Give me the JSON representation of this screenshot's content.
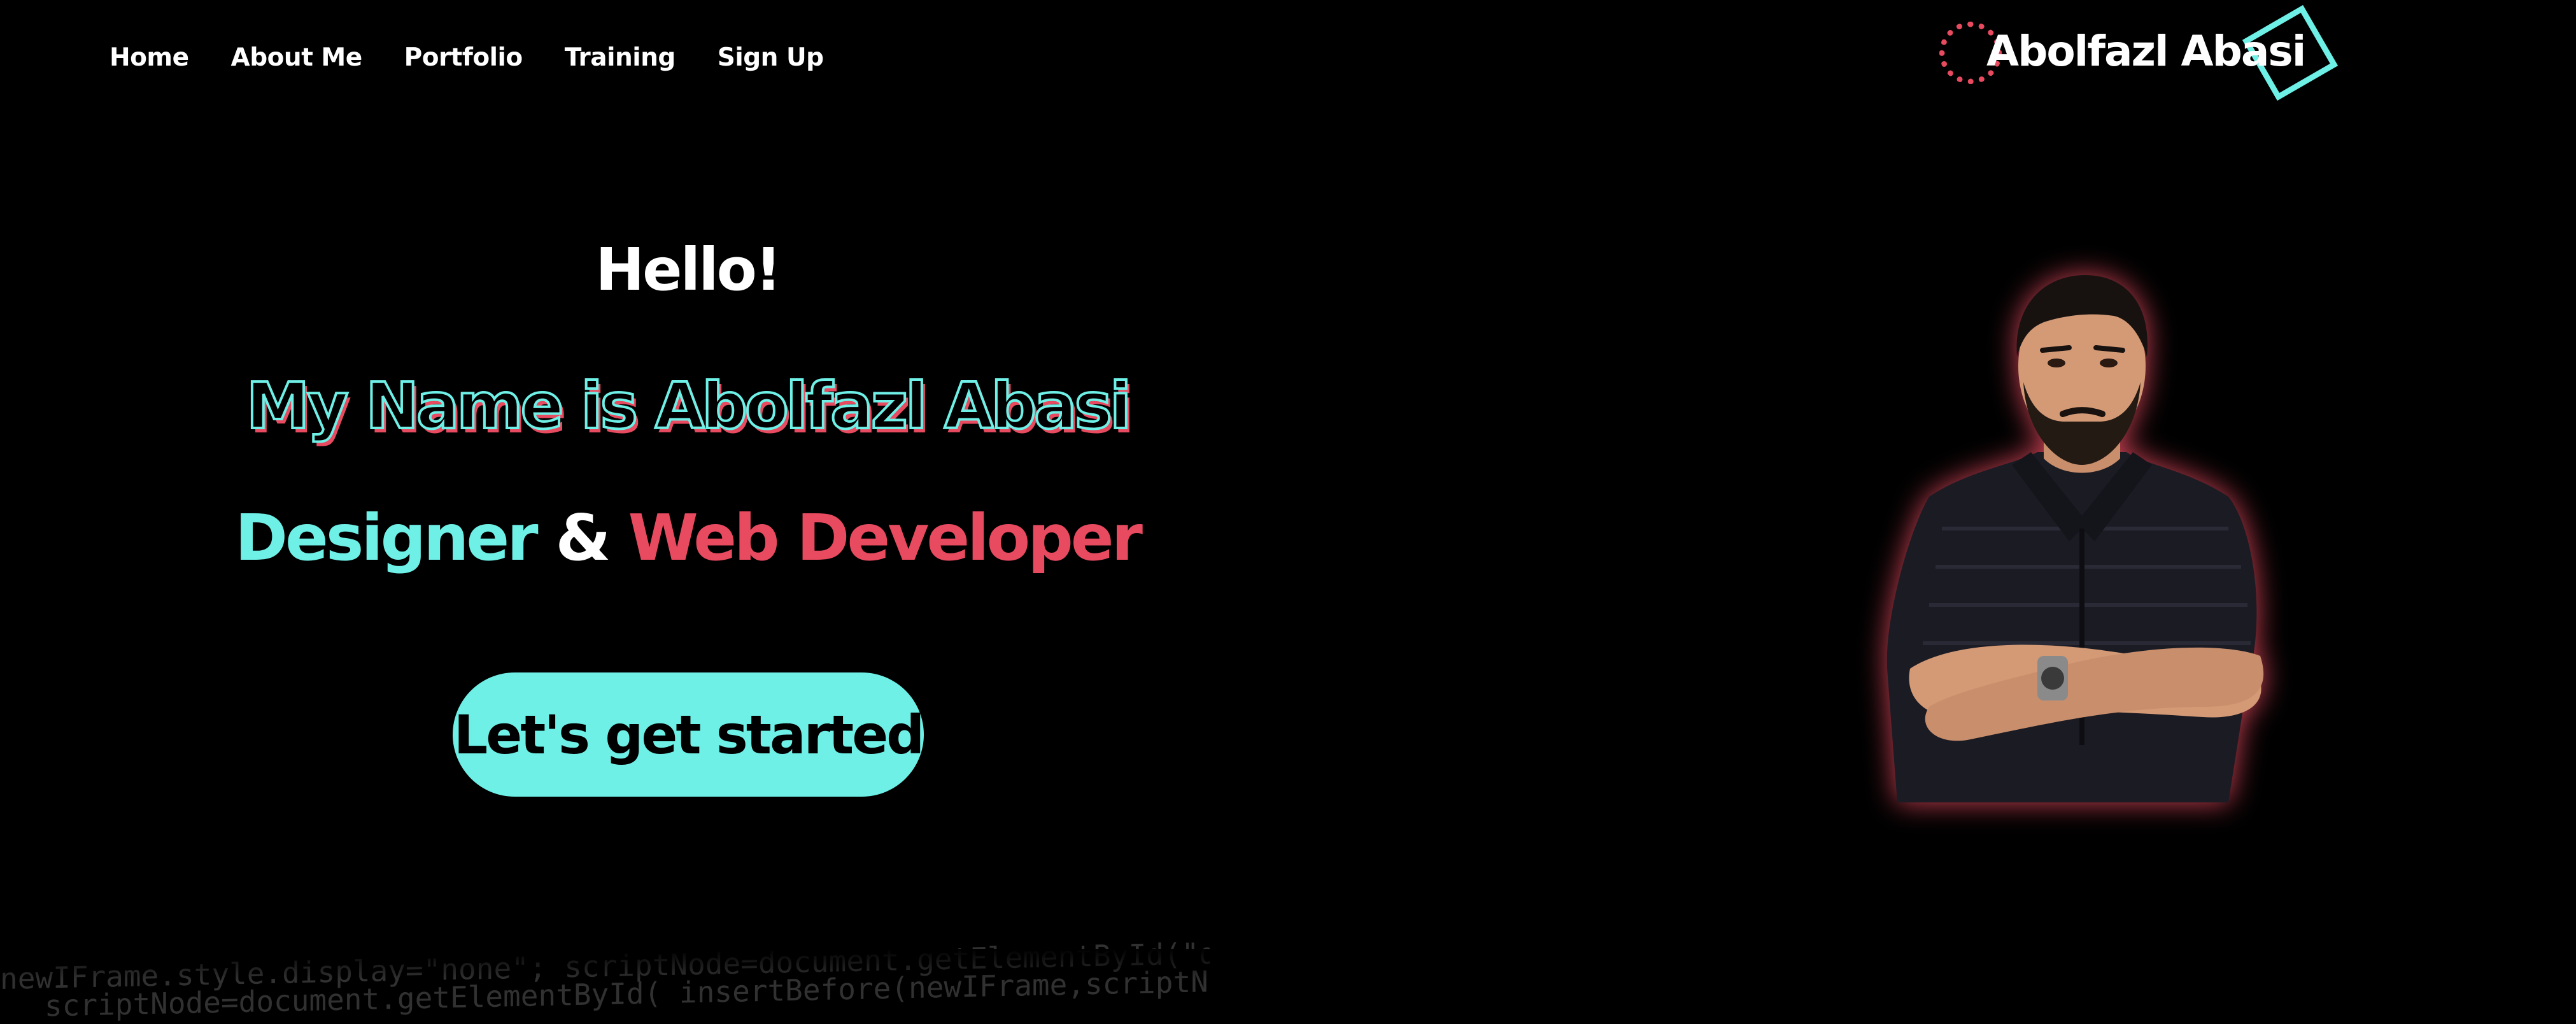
{
  "nav": {
    "items": [
      {
        "label": "Home"
      },
      {
        "label": "About Me"
      },
      {
        "label": "Portfolio"
      },
      {
        "label": "Training"
      },
      {
        "label": "Sign Up"
      }
    ]
  },
  "brand": {
    "name": "Abolfazl Abasi"
  },
  "hero": {
    "greeting": "Hello!",
    "intro": "My Name is Abolfazl Abasi",
    "role_designer": "Designer",
    "role_ampersand": "&",
    "role_developer": "Web Developer",
    "cta_label": "Let's get started"
  },
  "background": {
    "code_line_1": "newIFrame.style.display=\"none\";  scriptNode=document.getElementById(\"downlo",
    "code_line_2": "scriptNode=document.getElementById(  insertBefore(newIFrame,scriptNode);"
  },
  "colors": {
    "background": "#000000",
    "accent_cyan": "#6ef0e7",
    "accent_red": "#e84a5f",
    "text": "#ffffff"
  },
  "icons": {
    "brand_circle": "dotted-circle-icon",
    "brand_square": "rotated-square-icon"
  }
}
